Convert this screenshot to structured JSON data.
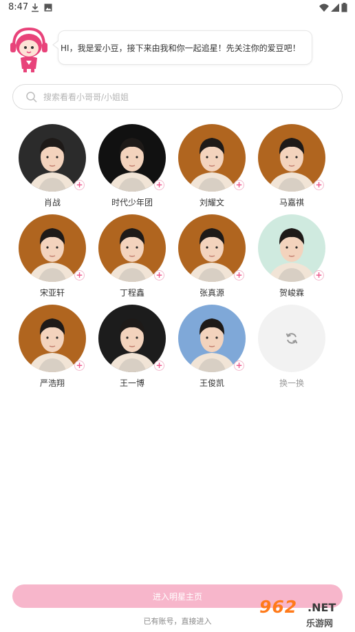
{
  "status_bar": {
    "time": "8:47"
  },
  "greeting": {
    "text": "HI，我是爱小豆，接下来由我和你一起追星！先关注你的爱豆吧！"
  },
  "search": {
    "placeholder": "搜索看看小哥哥/小姐姐"
  },
  "idols": [
    {
      "name": "肖战",
      "bg": "#2b2b2b"
    },
    {
      "name": "时代少年团",
      "bg": "#111111"
    },
    {
      "name": "刘耀文",
      "bg": "#b0651f"
    },
    {
      "name": "马嘉祺",
      "bg": "#b0651f"
    },
    {
      "name": "宋亚轩",
      "bg": "#b0651f"
    },
    {
      "name": "丁程鑫",
      "bg": "#b0651f"
    },
    {
      "name": "张真源",
      "bg": "#b0651f"
    },
    {
      "name": "贺峻霖",
      "bg": "#cfeadf"
    },
    {
      "name": "严浩翔",
      "bg": "#b0651f"
    },
    {
      "name": "王一博",
      "bg": "#1c1c1c"
    },
    {
      "name": "王俊凯",
      "bg": "#7fa8d8"
    }
  ],
  "refresh": {
    "label": "换一换"
  },
  "footer": {
    "enter_label": "进入明星主页",
    "login_text": "已有账号，直接进入"
  },
  "watermark": {
    "big": "962",
    "net": ".NET",
    "small": "乐游网"
  },
  "colors": {
    "accent_pink": "#ee5a8e",
    "button_pink": "#f7b6cb"
  }
}
